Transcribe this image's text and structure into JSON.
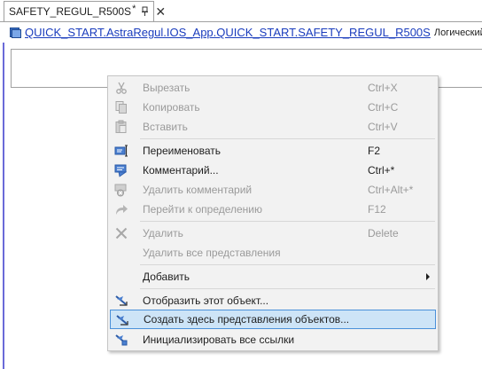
{
  "tab": {
    "title": "SAFETY_REGUL_R500S",
    "modified_mark": "*",
    "pin_icon": "pin-icon",
    "close_icon": "close-icon",
    "close_glyph": "✕"
  },
  "path": {
    "icon": "object-icon",
    "link1": "QUICK_START.AstraRegul.IOS_App.QUICK_START.",
    "link2": "SAFETY_REGUL_R500S",
    "description": "Логический о"
  },
  "context_menu": {
    "items": [
      {
        "icon": "scissors-icon",
        "label": "Вырезать",
        "shortcut": "Ctrl+X",
        "enabled": false
      },
      {
        "icon": "copy-icon",
        "label": "Копировать",
        "shortcut": "Ctrl+C",
        "enabled": false
      },
      {
        "icon": "paste-icon",
        "label": "Вставить",
        "shortcut": "Ctrl+V",
        "enabled": false
      },
      {
        "icon": "rename-icon",
        "label": "Переименовать",
        "shortcut": "F2",
        "enabled": true
      },
      {
        "icon": "comment-icon",
        "label": "Комментарий...",
        "shortcut": "Ctrl+*",
        "enabled": true
      },
      {
        "icon": "delete-comment-icon",
        "label": "Удалить комментарий",
        "shortcut": "Ctrl+Alt+*",
        "enabled": false
      },
      {
        "icon": "go-to-definition-icon",
        "label": "Перейти к определению",
        "shortcut": "F12",
        "enabled": false
      },
      {
        "icon": "delete-icon",
        "label": "Удалить",
        "shortcut": "Delete",
        "enabled": false
      },
      {
        "icon": "",
        "label": "Удалить все представления",
        "shortcut": "",
        "enabled": false
      },
      {
        "icon": "",
        "label": "Добавить",
        "shortcut": "",
        "enabled": true,
        "submenu": true
      },
      {
        "icon": "show-object-icon",
        "label": "Отобразить этот объект...",
        "shortcut": "",
        "enabled": true
      },
      {
        "icon": "create-views-icon",
        "label": "Создать здесь представления объектов...",
        "shortcut": "",
        "enabled": true,
        "highlighted": true
      },
      {
        "icon": "init-links-icon",
        "label": "Инициализировать все ссылки",
        "shortcut": "",
        "enabled": true
      }
    ]
  },
  "colors": {
    "link": "#1a3cbd",
    "highlight_bg": "#cde4f7",
    "highlight_border": "#4a90d9",
    "menu_bg": "#f2f2f2",
    "disabled_text": "#9a9a9a",
    "editor_border": "#6a6ad8"
  }
}
